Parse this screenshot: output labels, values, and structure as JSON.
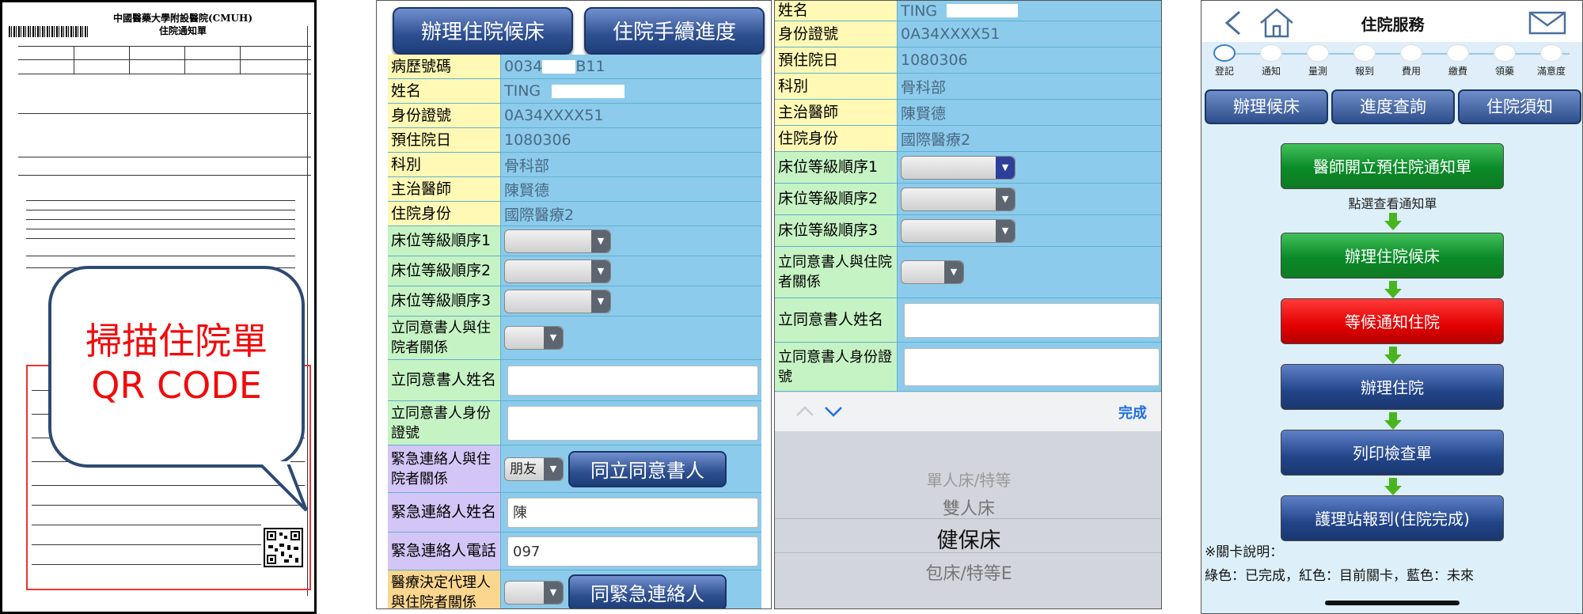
{
  "panel1": {
    "doc_title": "中國醫藥大學附設醫院(CMUH)",
    "doc_subtitle": "住院通知單",
    "bubble_line1": "掃描住院單",
    "bubble_line2": "QR CODE"
  },
  "panel2": {
    "btn_register": "辦理住院候床",
    "btn_progress": "住院手續進度",
    "rows": [
      {
        "label": "病歷號碼",
        "value": "0034",
        "value2": "B11"
      },
      {
        "label": "姓名",
        "value": "TING"
      },
      {
        "label": "身份證號",
        "value": "0A34XXXX51"
      },
      {
        "label": "預住院日",
        "value": "1080306"
      },
      {
        "label": "科別",
        "value": "骨科部"
      },
      {
        "label": "主治醫師",
        "value": "陳賢德"
      },
      {
        "label": "住院身份",
        "value": "國際醫療2"
      },
      {
        "label": "床位等級順序1"
      },
      {
        "label": "床位等級順序2"
      },
      {
        "label": "床位等級順序3"
      },
      {
        "label": "立同意書人與住院者關係"
      },
      {
        "label": "立同意書人姓名"
      },
      {
        "label": "立同意書人身份證號"
      },
      {
        "label": "緊急連絡人與住院者關係",
        "select_value": "朋友",
        "button": "同立同意書人"
      },
      {
        "label": "緊急連絡人姓名",
        "value": "陳"
      },
      {
        "label": "緊急連絡人電話",
        "value": "097"
      },
      {
        "label": "醫療決定代理人與住院者關係",
        "button": "同緊急連絡人"
      }
    ]
  },
  "panel3": {
    "rows": [
      {
        "label": "姓名",
        "value": "TING"
      },
      {
        "label": "身份證號",
        "value": "0A34XXXX51"
      },
      {
        "label": "預住院日",
        "value": "1080306"
      },
      {
        "label": "科別",
        "value": "骨科部"
      },
      {
        "label": "主治醫師",
        "value": "陳賢德"
      },
      {
        "label": "住院身份",
        "value": "國際醫療2"
      },
      {
        "label": "床位等級順序1"
      },
      {
        "label": "床位等級順序2"
      },
      {
        "label": "床位等級順序3"
      },
      {
        "label": "立同意書人與住院者關係"
      },
      {
        "label": "立同意書人姓名"
      },
      {
        "label": "立同意書人身份證號"
      }
    ],
    "done": "完成",
    "picker_options": [
      "單人床/特等",
      "雙人床",
      "健保床",
      "包床/特等E"
    ],
    "picker_selected": "健保床"
  },
  "panel4": {
    "title": "住院服務",
    "steps": [
      "登記",
      "通知",
      "量測",
      "報到",
      "費用",
      "繳費",
      "領藥",
      "滿意度"
    ],
    "tabs": [
      "辦理候床",
      "進度查詢",
      "住院須知"
    ],
    "flow": [
      {
        "label": "醫師開立預住院通知單",
        "status": "green"
      },
      {
        "label": "辦理住院候床",
        "status": "green"
      },
      {
        "label": "等候通知住院",
        "status": "red"
      },
      {
        "label": "辦理住院",
        "status": "blue"
      },
      {
        "label": "列印檢查單",
        "status": "blue"
      },
      {
        "label": "護理站報到(住院完成)",
        "status": "blue"
      }
    ],
    "hint": "點選查看通知單",
    "legend_title": "※關卡說明：",
    "legend_text": "綠色：已完成，紅色：目前關卡，藍色：未來"
  },
  "colors": {
    "label_yellow": "#fff9b5",
    "label_green": "#c6f3c4",
    "label_purple": "#d3c6f6",
    "label_orange": "#fbd68e",
    "value_blue": "#8ccbeb",
    "button_blue": "#2d4f8f"
  }
}
